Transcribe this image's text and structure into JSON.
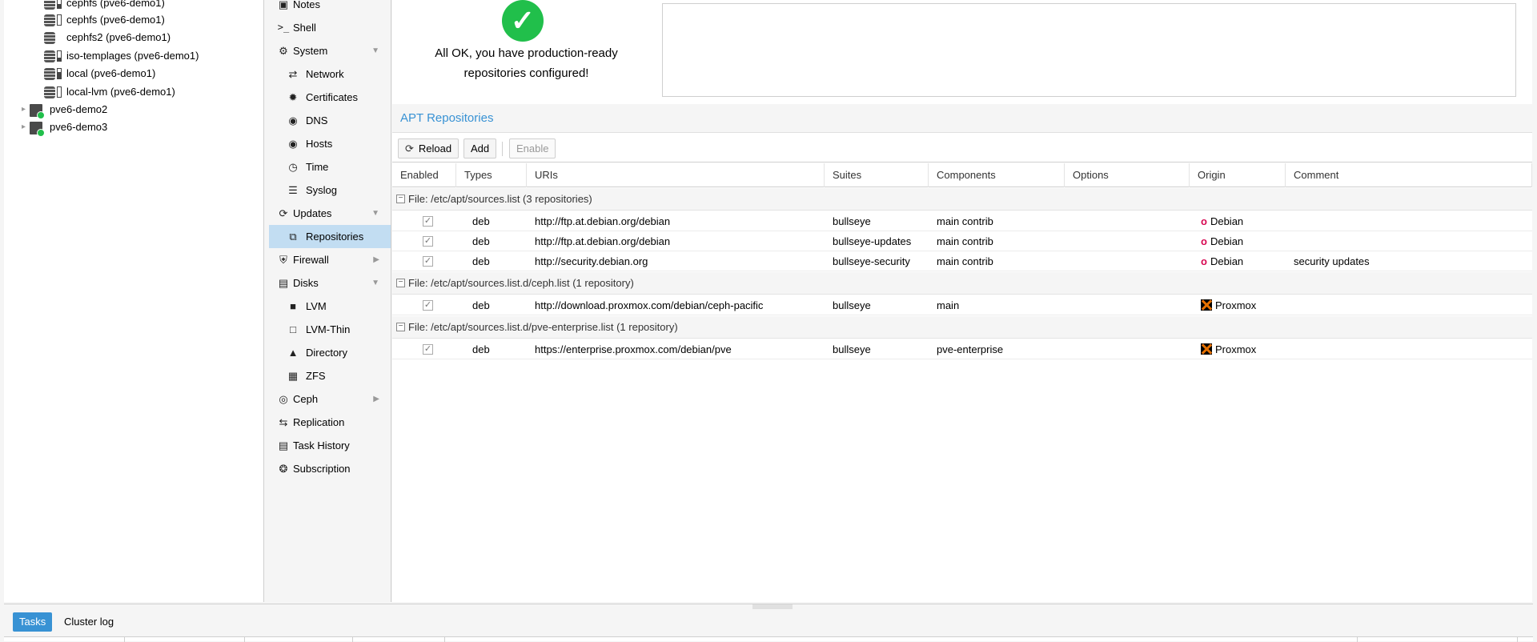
{
  "tree": {
    "storages": [
      {
        "label": "cephfs (pve6-demo1)",
        "icon": "storage-icon"
      },
      {
        "label": "cephfs (pve6-demo1)",
        "icon": "storage-icon"
      },
      {
        "label": "cephfs2 (pve6-demo1)",
        "icon": "storage-icon"
      },
      {
        "label": "iso-templages (pve6-demo1)",
        "icon": "storage-icon"
      },
      {
        "label": "local (pve6-demo1)",
        "icon": "storage-icon"
      },
      {
        "label": "local-lvm (pve6-demo1)",
        "icon": "storage-icon"
      }
    ],
    "nodes": [
      {
        "label": "pve6-demo2",
        "icon": "node-online-icon"
      },
      {
        "label": "pve6-demo3",
        "icon": "node-online-icon"
      }
    ]
  },
  "nav": {
    "items": [
      {
        "label": "Notes",
        "icon": "notes-icon"
      },
      {
        "label": "Shell",
        "icon": "terminal-icon"
      },
      {
        "label": "System",
        "icon": "gears-icon"
      },
      {
        "label": "Network",
        "icon": "exchange-icon"
      },
      {
        "label": "Certificates",
        "icon": "certificate-icon"
      },
      {
        "label": "DNS",
        "icon": "globe-icon"
      },
      {
        "label": "Hosts",
        "icon": "globe-icon"
      },
      {
        "label": "Time",
        "icon": "clock-icon"
      },
      {
        "label": "Syslog",
        "icon": "list-icon"
      },
      {
        "label": "Updates",
        "icon": "refresh-icon"
      },
      {
        "label": "Repositories",
        "icon": "files-icon"
      },
      {
        "label": "Firewall",
        "icon": "shield-icon"
      },
      {
        "label": "Disks",
        "icon": "hdd-icon"
      },
      {
        "label": "LVM",
        "icon": "square-icon"
      },
      {
        "label": "LVM-Thin",
        "icon": "square-outline-icon"
      },
      {
        "label": "Directory",
        "icon": "folder-icon"
      },
      {
        "label": "ZFS",
        "icon": "th-large-icon"
      },
      {
        "label": "Ceph",
        "icon": "ceph-icon"
      },
      {
        "label": "Replication",
        "icon": "retweet-icon"
      },
      {
        "label": "Task History",
        "icon": "list-alt-icon"
      },
      {
        "label": "Subscription",
        "icon": "support-icon"
      }
    ],
    "selected": "Repositories"
  },
  "status": {
    "icon": "check-circle-icon",
    "line1": "All OK, you have production-ready",
    "line2": "repositories configured!"
  },
  "repos": {
    "title": "APT Repositories",
    "toolbar": {
      "reload": "Reload",
      "add": "Add",
      "enable": "Enable"
    },
    "columns": [
      "Enabled",
      "Types",
      "URIs",
      "Suites",
      "Components",
      "Options",
      "Origin",
      "Comment"
    ],
    "groups": [
      {
        "title": "File: /etc/apt/sources.list (3 repositories)",
        "rows": [
          {
            "type": "deb",
            "uri": "http://ftp.at.debian.org/debian",
            "suite": "bullseye",
            "components": "main contrib",
            "options": "",
            "origin": "Debian",
            "comment": ""
          },
          {
            "type": "deb",
            "uri": "http://ftp.at.debian.org/debian",
            "suite": "bullseye-updates",
            "components": "main contrib",
            "options": "",
            "origin": "Debian",
            "comment": ""
          },
          {
            "type": "deb",
            "uri": "http://security.debian.org",
            "suite": "bullseye-security",
            "components": "main contrib",
            "options": "",
            "origin": "Debian",
            "comment": "security updates"
          }
        ]
      },
      {
        "title": "File: /etc/apt/sources.list.d/ceph.list (1 repository)",
        "rows": [
          {
            "type": "deb",
            "uri": "http://download.proxmox.com/debian/ceph-pacific",
            "suite": "bullseye",
            "components": "main",
            "options": "",
            "origin": "Proxmox",
            "comment": ""
          }
        ]
      },
      {
        "title": "File: /etc/apt/sources.list.d/pve-enterprise.list (1 repository)",
        "rows": [
          {
            "type": "deb",
            "uri": "https://enterprise.proxmox.com/debian/pve",
            "suite": "bullseye",
            "components": "pve-enterprise",
            "options": "",
            "origin": "Proxmox",
            "comment": ""
          }
        ]
      }
    ]
  },
  "bottom": {
    "tabs": [
      "Tasks",
      "Cluster log"
    ]
  },
  "colors": {
    "accent": "#3892d4",
    "ok": "#21bf4b",
    "selected": "#c2ddf2",
    "debian": "#d70751",
    "proxmox": "#e57000"
  }
}
